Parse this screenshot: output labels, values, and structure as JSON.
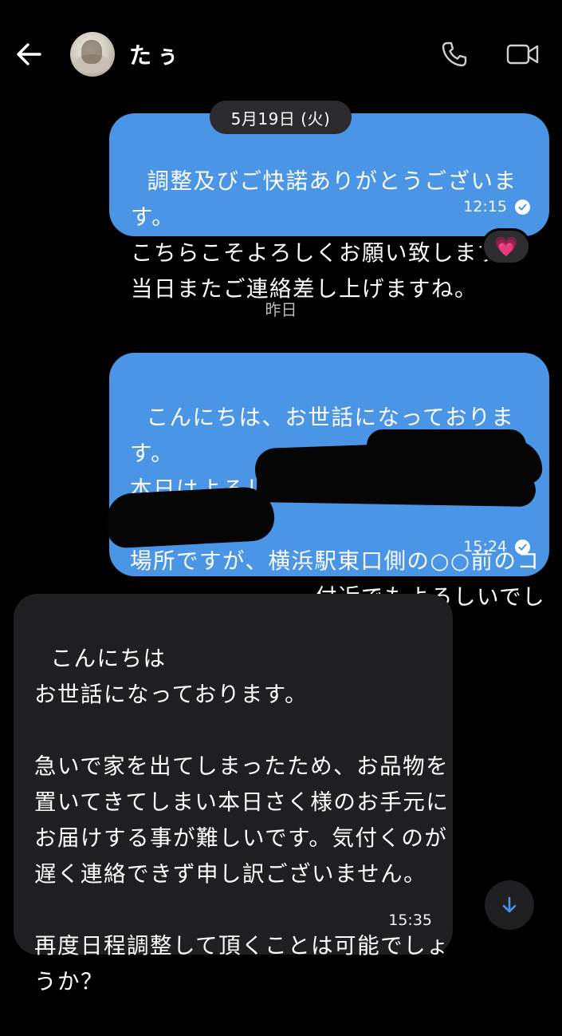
{
  "header": {
    "contact_name": "たぅ",
    "icons": {
      "back": "arrow-left-icon",
      "avatar": "contact-avatar",
      "call": "phone-icon",
      "video": "video-camera-icon"
    }
  },
  "messages": [
    {
      "id": "msg1",
      "direction": "outgoing",
      "text": "調整及びご快諾ありがとうございます。\nこちらこそよろしくお願い致します。\n当日またご連絡差し上げますね。",
      "time": "12:15",
      "status": "read",
      "reaction": "💗"
    },
    {
      "id": "msg2",
      "direction": "outgoing",
      "text": "こんにちは、お世話になっております。\n本日はよろしくお願い致します。\n\n場所ですが、横浜駅東口側の○○前のコ\n　　　　　　　ー付近でもよろしいでしょう\nか？",
      "time": "15:24",
      "status": "read"
    },
    {
      "id": "msg3",
      "direction": "incoming",
      "text": "こんにちは\nお世話になっております。\n\n急いで家を出てしまったため、お品物を\n置いてきてしまい本日さく様のお手元に\nお届けする事が難しいです。気付くのが\n遅く連絡できず申し訳ございません。\n\n再度日程調整して頂くことは可能でしょ\nうか？",
      "time": "15:35"
    }
  ],
  "date_pill": "5月19日 (火)",
  "day_separator": "昨日",
  "colors": {
    "background": "#000000",
    "outgoing_bubble": "#4a95e6",
    "incoming_bubble": "#1f1f21",
    "date_pill": "#2b2b2e"
  },
  "scroll_down_icon": "arrow-down-icon"
}
